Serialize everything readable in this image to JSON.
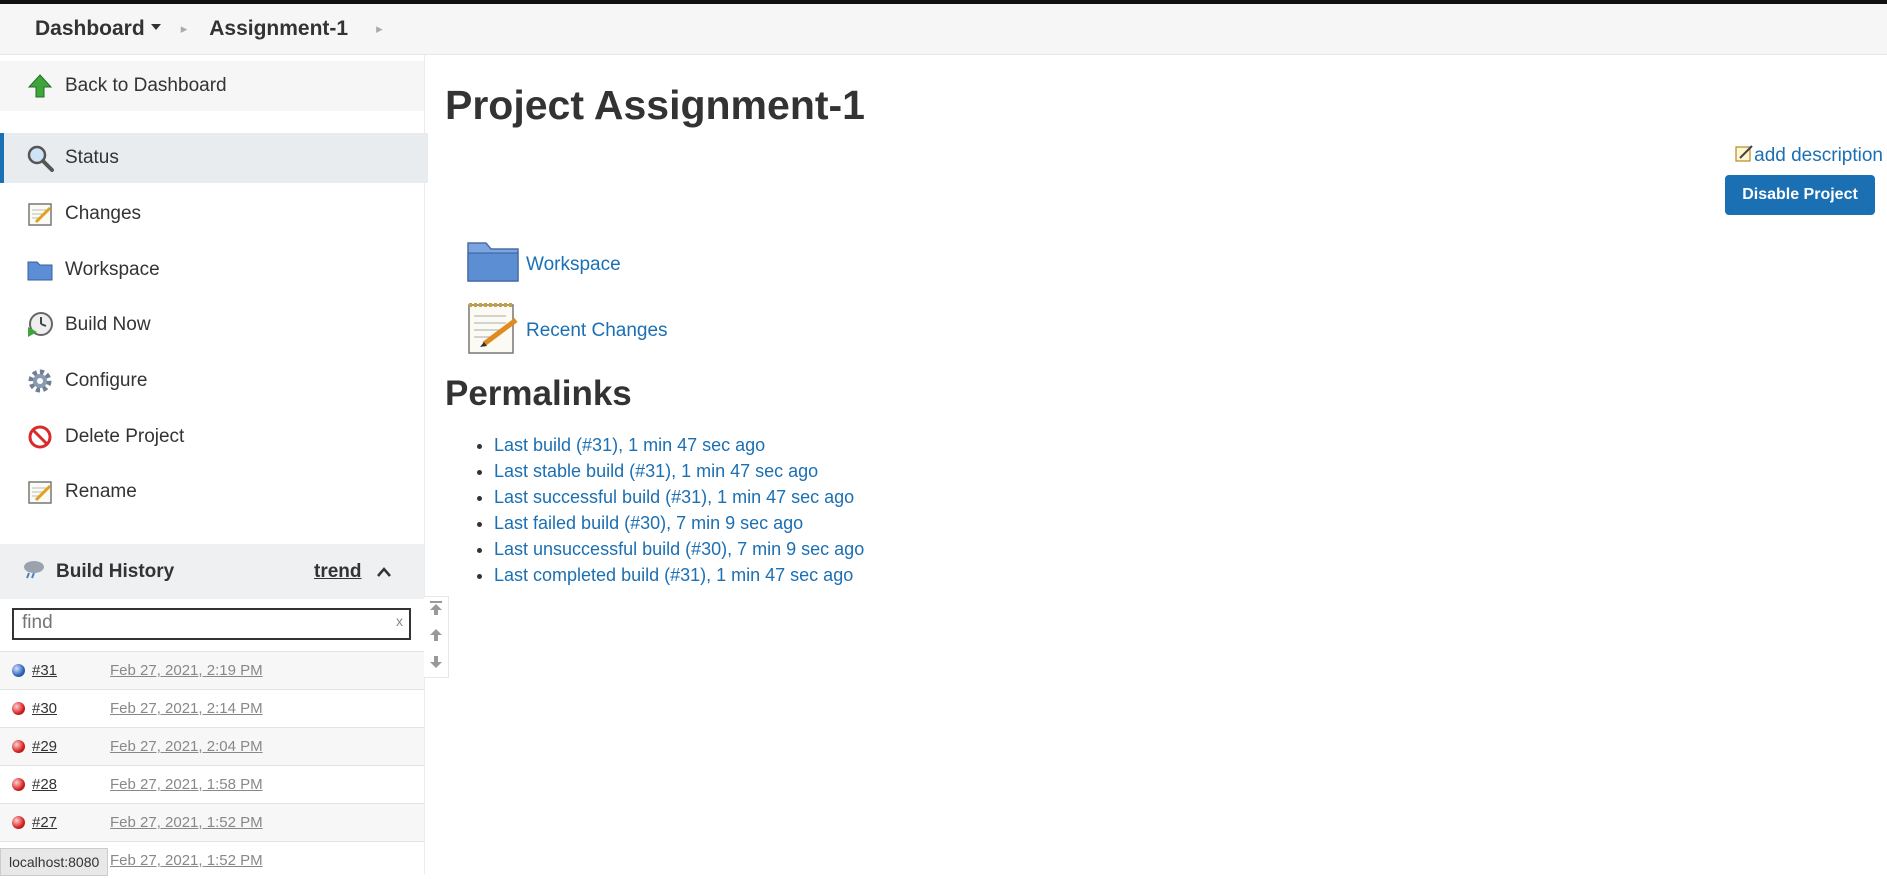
{
  "breadcrumb": {
    "dashboard": "Dashboard",
    "project": "Assignment-1"
  },
  "sidebar": {
    "items": [
      {
        "label": "Back to Dashboard",
        "icon": "up-arrow-icon"
      },
      {
        "label": "Status",
        "icon": "magnifier-icon"
      },
      {
        "label": "Changes",
        "icon": "notepad-icon"
      },
      {
        "label": "Workspace",
        "icon": "folder-icon"
      },
      {
        "label": "Build Now",
        "icon": "clock-play-icon"
      },
      {
        "label": "Configure",
        "icon": "gear-icon"
      },
      {
        "label": "Delete Project",
        "icon": "no-entry-icon"
      },
      {
        "label": "Rename",
        "icon": "notepad-icon"
      }
    ]
  },
  "build_history": {
    "title": "Build History",
    "trend": "trend",
    "find_placeholder": "find",
    "clear": "x",
    "builds": [
      {
        "num": "#31",
        "date": "Feb 27, 2021, 2:19 PM",
        "status": "blue"
      },
      {
        "num": "#30",
        "date": "Feb 27, 2021, 2:14 PM",
        "status": "red"
      },
      {
        "num": "#29",
        "date": "Feb 27, 2021, 2:04 PM",
        "status": "red"
      },
      {
        "num": "#28",
        "date": "Feb 27, 2021, 1:58 PM",
        "status": "red"
      },
      {
        "num": "#27",
        "date": "Feb 27, 2021, 1:52 PM",
        "status": "red"
      },
      {
        "num": "",
        "date": "Feb 27, 2021, 1:52 PM",
        "status": "red"
      }
    ]
  },
  "status_bar": "localhost:8080",
  "main": {
    "title": "Project Assignment-1",
    "add_description": "add description",
    "disable_button": "Disable Project",
    "links": [
      {
        "label": "Workspace",
        "icon": "folder-icon"
      },
      {
        "label": "Recent Changes",
        "icon": "notepad-icon"
      }
    ],
    "permalinks_title": "Permalinks",
    "permalinks": [
      "Last build (#31), 1 min 47 sec ago",
      "Last stable build (#31), 1 min 47 sec ago",
      "Last successful build (#31), 1 min 47 sec ago",
      "Last failed build (#30), 7 min 9 sec ago",
      "Last unsuccessful build (#30), 7 min 9 sec ago",
      "Last completed build (#31), 1 min 47 sec ago"
    ]
  },
  "colors": {
    "accent": "#1b6fb3",
    "success": "#2f62b8",
    "failure": "#d52020"
  }
}
